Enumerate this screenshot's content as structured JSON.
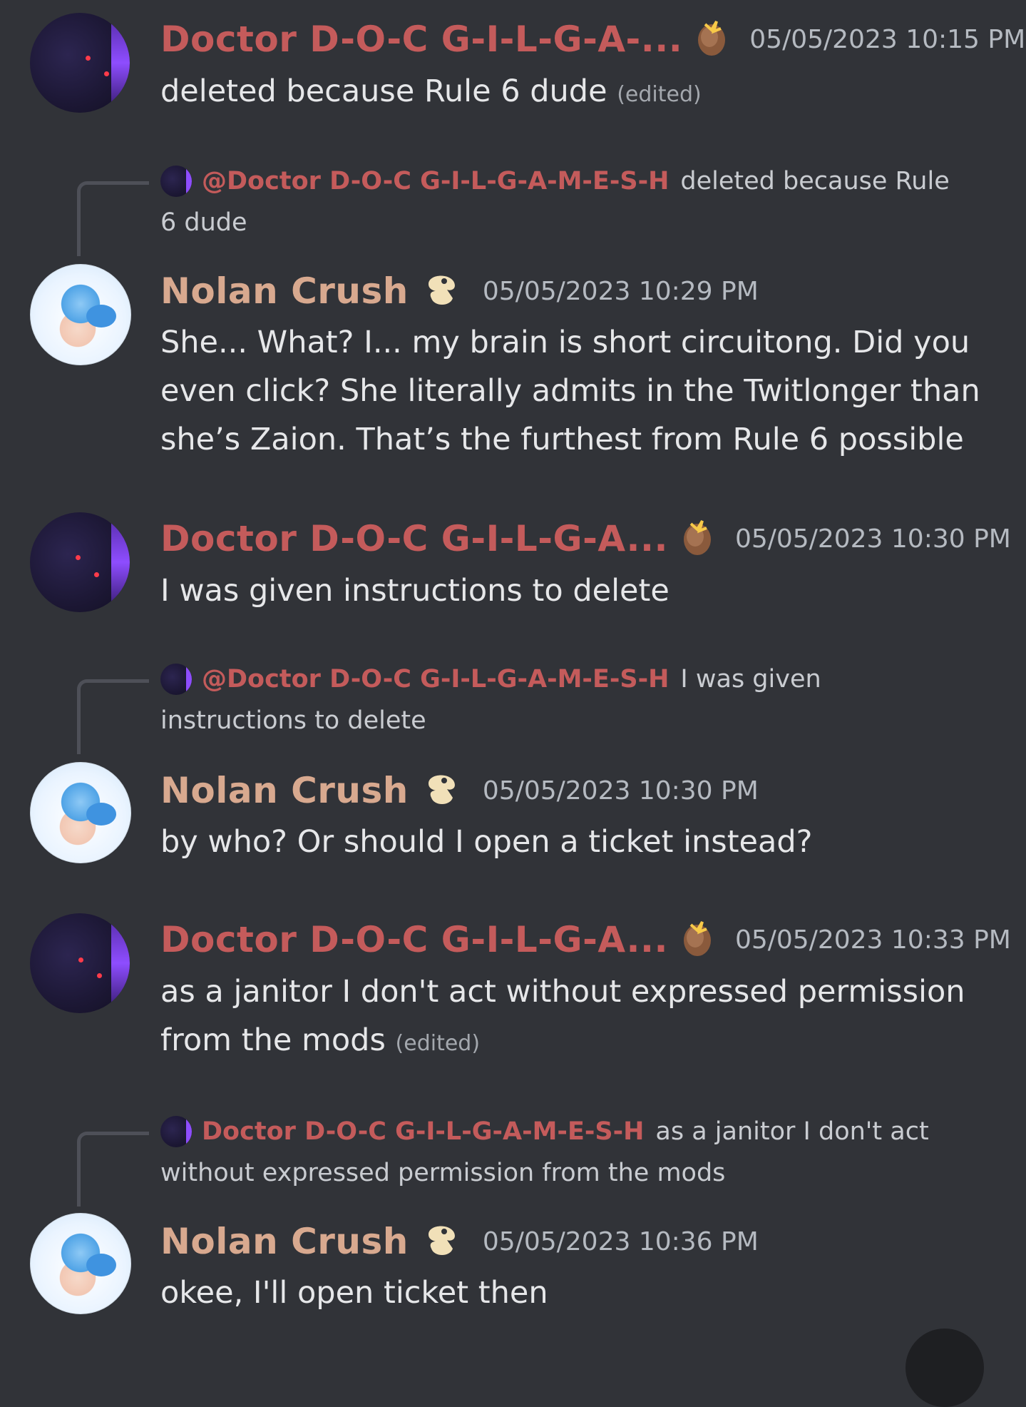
{
  "messages": [
    {
      "author": "Doctor D-O-C G-I-L-G-A-...",
      "timestamp": "05/05/2023 10:15 PM",
      "lines": [
        "deleted because Rule 6 dude"
      ],
      "edited": "(edited)"
    },
    {
      "reply_to": {
        "author": "@Doctor D-O-C G-I-L-G-A-M-E-S-H",
        "text_line1": "deleted because Rule",
        "text_line2": "6 dude"
      },
      "author": "Nolan Crush",
      "timestamp": "05/05/2023 10:29 PM",
      "lines": [
        "She... What? I... my brain is short circuitong. Did you",
        "even click? She literally admits in the Twitlonger than",
        "she’s Zaion. That’s the furthest from Rule 6 possible"
      ]
    },
    {
      "author": "Doctor D-O-C G-I-L-G-A...",
      "timestamp": "05/05/2023 10:30 PM",
      "lines": [
        "I was given instructions to delete"
      ]
    },
    {
      "reply_to": {
        "author": "@Doctor D-O-C G-I-L-G-A-M-E-S-H",
        "text_line1": "I was given",
        "text_line2": "instructions to delete"
      },
      "author": "Nolan Crush",
      "timestamp": "05/05/2023 10:30 PM",
      "lines": [
        "by who? Or should I open a ticket instead?"
      ]
    },
    {
      "author": "Doctor D-O-C G-I-L-G-A...",
      "timestamp": "05/05/2023 10:33 PM",
      "lines": [
        "as a janitor I don't act without expressed permission",
        "from the mods"
      ],
      "edited": "(edited)"
    },
    {
      "reply_to": {
        "author": "Doctor D-O-C G-I-L-G-A-M-E-S-H",
        "text_line1": "as a janitor I don't act",
        "text_line2": "without expressed permission from the mods"
      },
      "author": "Nolan Crush",
      "timestamp": "05/05/2023 10:36 PM",
      "lines": [
        "okee, I'll open ticket then"
      ]
    }
  ],
  "icons": {
    "doctor_badge": "potato-icon",
    "nolan_badge": "tooth-icon"
  },
  "colors": {
    "background": "#313338",
    "doctor_name": "#c45b5b",
    "nolan_name": "#d8a98f",
    "timestamp": "#b5bac1"
  }
}
